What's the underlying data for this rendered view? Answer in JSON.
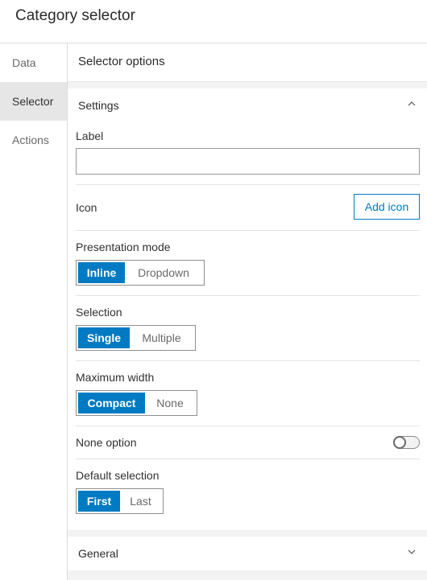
{
  "header": {
    "title": "Category selector"
  },
  "sidebar": {
    "items": [
      {
        "label": "Data"
      },
      {
        "label": "Selector"
      },
      {
        "label": "Actions"
      }
    ],
    "active": "Selector"
  },
  "main": {
    "title": "Selector options",
    "settings": {
      "title": "Settings",
      "label_field": {
        "label": "Label",
        "value": "",
        "placeholder": ""
      },
      "icon": {
        "label": "Icon",
        "button": "Add icon"
      },
      "presentation_mode": {
        "label": "Presentation mode",
        "options": [
          "Inline",
          "Dropdown"
        ],
        "selected": "Inline"
      },
      "selection": {
        "label": "Selection",
        "options": [
          "Single",
          "Multiple"
        ],
        "selected": "Single"
      },
      "maximum_width": {
        "label": "Maximum width",
        "options": [
          "Compact",
          "None"
        ],
        "selected": "Compact"
      },
      "none_option": {
        "label": "None option",
        "enabled": false
      },
      "default_selection": {
        "label": "Default selection",
        "options": [
          "First",
          "Last"
        ],
        "selected": "First"
      }
    },
    "general": {
      "title": "General"
    }
  },
  "colors": {
    "accent": "#007ac2",
    "panel_bg": "#f3f3f3",
    "active_nav": "#e6e6e6"
  }
}
